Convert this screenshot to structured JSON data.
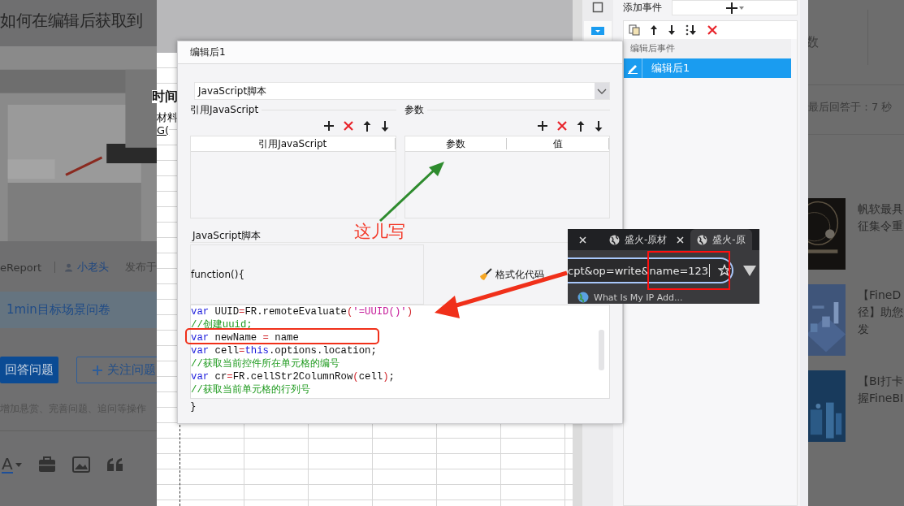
{
  "question_page": {
    "title": "如何在编辑后获取到",
    "thumbnail": {
      "kind": "picture"
    },
    "byline": {
      "product": "eReport",
      "author": "小老头",
      "published": "发布于"
    },
    "survey_banner": "1min目标场景问卷",
    "actions": [
      {
        "label": "回答问题",
        "kind": "primary"
      },
      {
        "label": "关注问题",
        "kind": "follow"
      }
    ],
    "hint": "增加悬赏、完善问题、追问等操作",
    "editor_toolbar": {
      "font_color_glyph": "A"
    },
    "stats_label": "数",
    "last_answer": "最后回答于：7 秒",
    "articles": [
      {
        "image": {
          "kind": "picture"
        },
        "lines": [
          "帆软最具",
          "征集令重"
        ]
      },
      {
        "image": {
          "kind": "picture"
        },
        "lines": [
          "【FineD",
          "径】助您",
          "发"
        ]
      },
      {
        "image": {
          "kind": "picture"
        },
        "lines": [
          "【BI打卡",
          "握FineBI"
        ]
      }
    ]
  },
  "designer": {
    "sheet_texts": [
      {
        "text": "时间",
        "kind": "heading"
      },
      {
        "text": "材料",
        "kind": "plain"
      },
      {
        "text": "G(",
        "kind": "link"
      }
    ],
    "events": {
      "add_label": "添加事件",
      "list_header": "编辑后事件",
      "items": [
        {
          "label": "编辑后1",
          "selected": true
        }
      ]
    }
  },
  "dialog": {
    "title": "编辑后1",
    "type_select": "JavaScript脚本",
    "js_section": {
      "title": "引用JavaScript",
      "columns": [
        "引用JavaScript"
      ]
    },
    "param_section": {
      "title": "参数",
      "columns": [
        "参数",
        "值"
      ]
    },
    "script_label": "JavaScript脚本",
    "function_header": "function(){",
    "format_button": "格式化代码",
    "code_lines": [
      [
        {
          "t": "var",
          "kind": "keyword"
        },
        {
          "t": " UUID",
          "kind": "plain"
        },
        {
          "t": "=",
          "kind": "op"
        },
        {
          "t": "FR.remoteEvaluate",
          "kind": "plain"
        },
        {
          "t": "(",
          "kind": "op"
        },
        {
          "t": "'=UUID()'",
          "kind": "string"
        },
        {
          "t": ")",
          "kind": "op"
        }
      ],
      [
        {
          "t": "//创建uuid;",
          "kind": "comment"
        }
      ],
      [
        {
          "t": "var",
          "kind": "keyword"
        },
        {
          "t": " newName ",
          "kind": "plain"
        },
        {
          "t": "=",
          "kind": "op"
        },
        {
          "t": " name",
          "kind": "plain"
        }
      ],
      [
        {
          "t": "var",
          "kind": "keyword"
        },
        {
          "t": " cell",
          "kind": "plain"
        },
        {
          "t": "=",
          "kind": "op"
        },
        {
          "t": "this",
          "kind": "keyword"
        },
        {
          "t": ".options.location;",
          "kind": "plain"
        }
      ],
      [
        {
          "t": "//获取当前控件所在单元格的编号",
          "kind": "comment"
        }
      ],
      [
        {
          "t": "var",
          "kind": "keyword"
        },
        {
          "t": " cr",
          "kind": "plain"
        },
        {
          "t": "=",
          "kind": "op"
        },
        {
          "t": "FR.cellStr2ColumnRow",
          "kind": "plain"
        },
        {
          "t": "(",
          "kind": "op"
        },
        {
          "t": "cell",
          "kind": "plain"
        },
        {
          "t": ")",
          "kind": "op"
        },
        {
          "t": ";",
          "kind": "plain"
        }
      ],
      [
        {
          "t": "//获取当前单元格的行列号",
          "kind": "comment"
        }
      ]
    ],
    "closing": "}"
  },
  "browser": {
    "tabs": [
      {
        "title": "盛火-原材",
        "selected": false
      },
      {
        "title": "盛火-原",
        "selected": true
      }
    ],
    "url": "cpt&op=write&name=123",
    "bookmark": "What Is My IP Add..."
  },
  "annotations": {
    "note": "这儿写"
  }
}
